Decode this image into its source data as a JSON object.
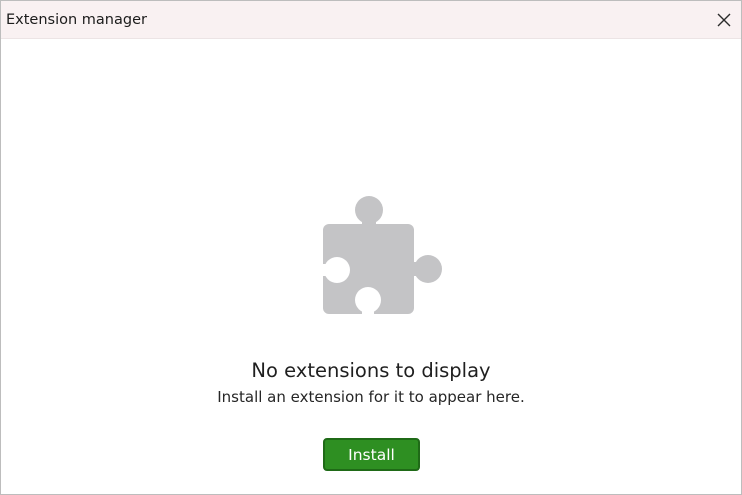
{
  "window": {
    "title": "Extension manager"
  },
  "empty_state": {
    "icon": "puzzle-piece-icon",
    "title": "No extensions to display",
    "subtitle": "Install an extension for it to appear here.",
    "install_label": "Install"
  },
  "colors": {
    "titlebar_bg": "#f9f1f2",
    "icon_gray": "#c4c4c6",
    "button_green": "#2e8f22",
    "button_border": "#1f6a17"
  }
}
